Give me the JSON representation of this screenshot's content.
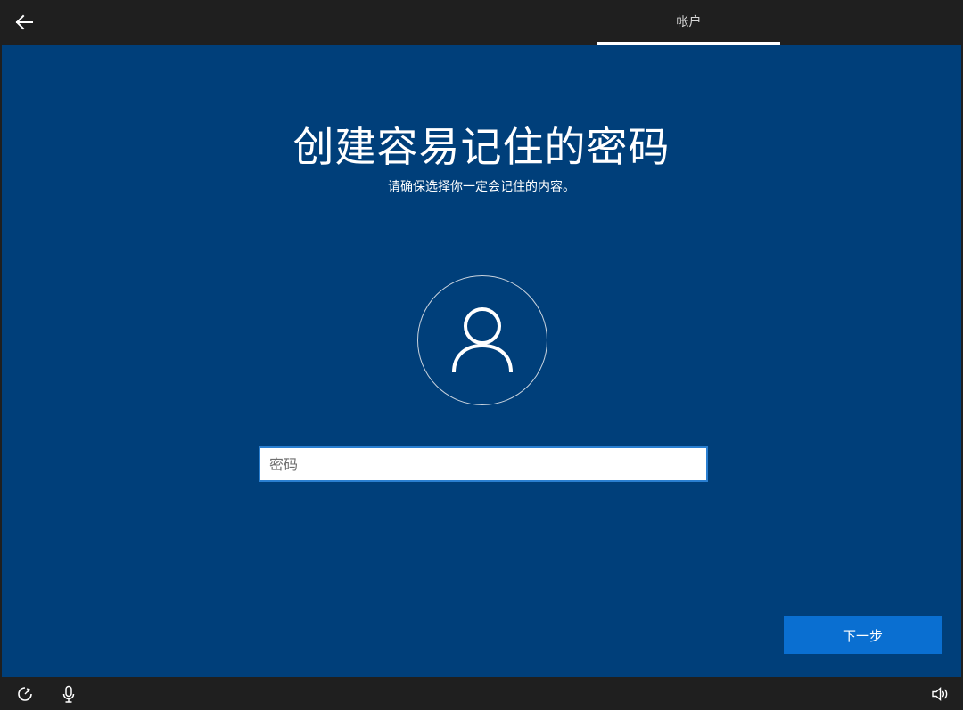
{
  "header": {
    "tab_label": "帐户"
  },
  "main": {
    "title": "创建容易记住的密码",
    "subtitle": "请确保选择你一定会记住的内容。",
    "password_placeholder": "密码",
    "password_value": "",
    "next_label": "下一步"
  },
  "icons": {
    "back": "back-arrow-icon",
    "avatar": "user-icon",
    "accessibility": "ease-of-access-icon",
    "microphone": "microphone-icon",
    "volume": "volume-icon"
  },
  "colors": {
    "background": "#003f7a",
    "chrome": "#1f1f1f",
    "accent": "#0a6fd1",
    "input_border": "#2a7fd1"
  }
}
